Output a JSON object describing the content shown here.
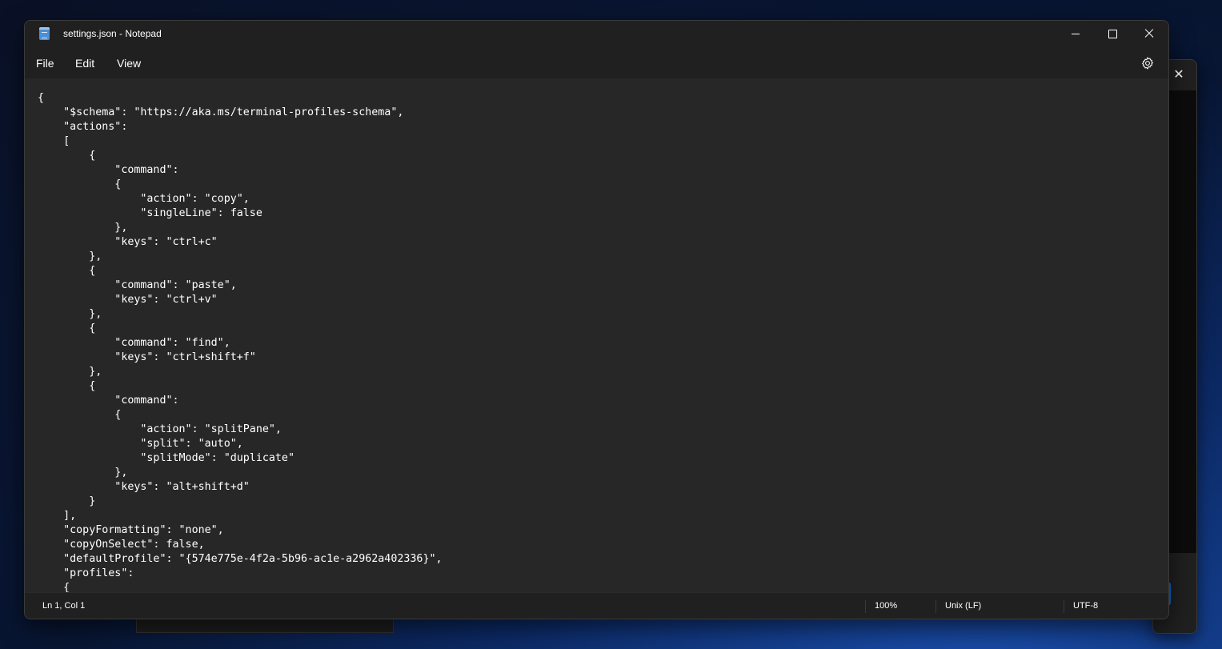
{
  "window": {
    "title": "settings.json - Notepad",
    "icon": "notepad-icon"
  },
  "menu": {
    "file": "File",
    "edit": "Edit",
    "view": "View"
  },
  "editor": {
    "content": "{\n    \"$schema\": \"https://aka.ms/terminal-profiles-schema\",\n    \"actions\":\n    [\n        {\n            \"command\":\n            {\n                \"action\": \"copy\",\n                \"singleLine\": false\n            },\n            \"keys\": \"ctrl+c\"\n        },\n        {\n            \"command\": \"paste\",\n            \"keys\": \"ctrl+v\"\n        },\n        {\n            \"command\": \"find\",\n            \"keys\": \"ctrl+shift+f\"\n        },\n        {\n            \"command\":\n            {\n                \"action\": \"splitPane\",\n                \"split\": \"auto\",\n                \"splitMode\": \"duplicate\"\n            },\n            \"keys\": \"alt+shift+d\"\n        }\n    ],\n    \"copyFormatting\": \"none\",\n    \"copyOnSelect\": false,\n    \"defaultProfile\": \"{574e775e-4f2a-5b96-ac1e-a2962a402336}\",\n    \"profiles\":\n    {"
  },
  "status": {
    "cursor": "Ln 1, Col 1",
    "zoom": "100%",
    "line_ending": "Unix (LF)",
    "encoding": "UTF-8"
  },
  "colors": {
    "editor_background": "#272727",
    "chrome_background": "#202020",
    "text": "#ffffff"
  }
}
